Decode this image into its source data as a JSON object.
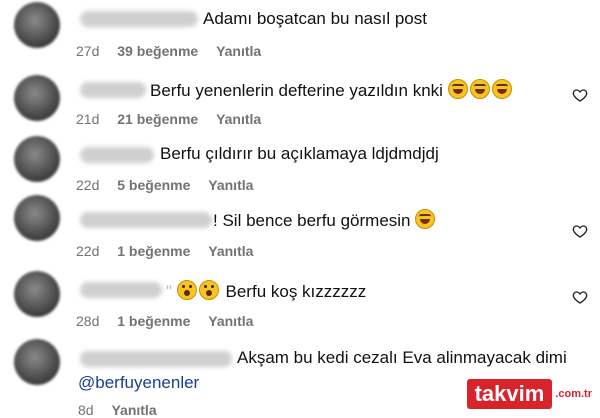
{
  "comments": [
    {
      "text": "Adamı boşatcan bu nasıl post",
      "time": "27d",
      "likes": "39 beğenme",
      "reply": "Yanıtla"
    },
    {
      "text": "Berfu yenenlerin defterine yazıldın knki",
      "emoji": [
        "laugh-emoji",
        "laugh-emoji",
        "laugh-emoji"
      ],
      "time": "21d",
      "likes": "21 beğenme",
      "reply": "Yanıtla"
    },
    {
      "text": "Berfu çıldırır bu açıklamaya ldjdmdjdj",
      "time": "22d",
      "likes": "5 beğenme",
      "reply": "Yanıtla"
    },
    {
      "text": "Sil bence berfu görmesin",
      "prefix": "!",
      "emoji": [
        "laugh-emoji"
      ],
      "time": "22d",
      "likes": "1 beğenme",
      "reply": "Yanıtla"
    },
    {
      "text": "Berfu koş kızzzzzz",
      "prefix": "\"",
      "emoji": [
        "surprised-emoji",
        "surprised-emoji"
      ],
      "time": "28d",
      "likes": "1 beğenme",
      "reply": "Yanıtla"
    },
    {
      "text": "Akşam bu kedi cezalı Eva alinmayacak dimi",
      "mention": "@berfuyenenler",
      "time": "8d",
      "reply": "Yanıtla"
    }
  ],
  "icons": {
    "like": "heart-outline-icon"
  },
  "watermark": {
    "text": "takvim",
    "suffix": ".com.tr",
    "color": "#d8232a"
  }
}
